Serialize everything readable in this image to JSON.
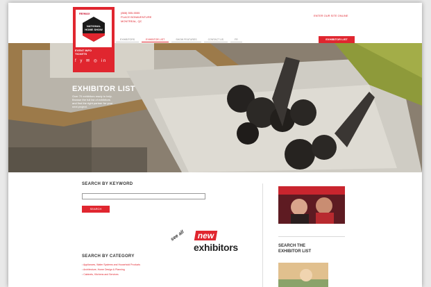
{
  "brand": {
    "remax": "RE/MAX",
    "logo_name": "NATIONAL HOME SHOW",
    "logo_sub_1": "EVENT INFO",
    "logo_sub_2": "TICKETS",
    "social": "f y ✉ ◎ in"
  },
  "contact": {
    "line1": "(888) 555-5555",
    "line2": "PLACE BONAVENTURE",
    "line3": "MONTREAL, QC"
  },
  "top_link": "ENTER OUR SITE ONLINE",
  "nav": [
    "EXHIBITORS",
    "EXHIBITOR LIST",
    "SHOW FEATURES",
    "CONTACT US",
    "FR"
  ],
  "cta": "EXHIBITOR LIST",
  "hero": {
    "title": "EXHIBITOR LIST",
    "text": "Over 70 exhibitors ready to help. Browse the full list of exhibitors and find the right partner for your next project."
  },
  "search": {
    "heading": "SEARCH BY KEYWORD",
    "placeholder": "",
    "button": "SEARCH"
  },
  "new_badge": {
    "see": "see all",
    "new": "new",
    "exhibitors": "exhibitors"
  },
  "category": {
    "heading": "SEARCH BY CATEGORY",
    "items": [
      "Appliances, Water Systems and Household Products",
      "Architecture, Home Design & Planning",
      "Cabinets, Kitchens and Services"
    ]
  },
  "sidebar": {
    "heading_1": "SEARCH THE",
    "heading_2": "EXHIBITOR LIST"
  }
}
